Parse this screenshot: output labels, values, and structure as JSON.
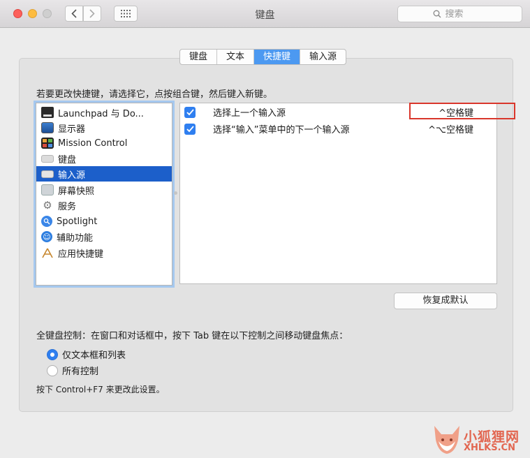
{
  "window": {
    "title": "键盘"
  },
  "search": {
    "placeholder": "搜索"
  },
  "tabs": [
    {
      "label": "键盘"
    },
    {
      "label": "文本"
    },
    {
      "label": "快捷键",
      "active": true
    },
    {
      "label": "输入源"
    }
  ],
  "instruction": "若要更改快捷键，请选择它，点按组合键，然后键入新键。",
  "categories": [
    {
      "label": "Launchpad 与 Do...",
      "icon": "launchpad-icon"
    },
    {
      "label": "显示器",
      "icon": "display-icon"
    },
    {
      "label": "Mission Control",
      "icon": "mission-control-icon"
    },
    {
      "label": "键盘",
      "icon": "keyboard-icon"
    },
    {
      "label": "输入源",
      "icon": "input-source-icon",
      "selected": true
    },
    {
      "label": "屏幕快照",
      "icon": "screenshot-icon"
    },
    {
      "label": "服务",
      "icon": "gear-icon"
    },
    {
      "label": "Spotlight",
      "icon": "spotlight-icon"
    },
    {
      "label": "辅助功能",
      "icon": "accessibility-icon"
    },
    {
      "label": "应用快捷键",
      "icon": "app-shortcuts-icon"
    }
  ],
  "shortcuts": [
    {
      "name": "选择上一个输入源",
      "key": "^空格键",
      "checked": true
    },
    {
      "name": "选择“输入”菜单中的下一个输入源",
      "key": "^⌥空格键",
      "checked": true
    }
  ],
  "restore_button": "恢复成默认",
  "full_keyboard": {
    "label": "全键盘控制：在窗口和对话框中，按下 Tab 键在以下控制之间移动键盘焦点：",
    "options": [
      {
        "label": "仅文本框和列表",
        "selected": true
      },
      {
        "label": "所有控制",
        "selected": false
      }
    ]
  },
  "hint": "按下 Control+F7 来更改此设置。",
  "watermark": {
    "text": "小狐狸网",
    "url": "XHLKS.CN"
  },
  "colors": {
    "accent": "#2f7ff0",
    "selection": "#1c5fca",
    "highlight_box": "#d9362b"
  }
}
